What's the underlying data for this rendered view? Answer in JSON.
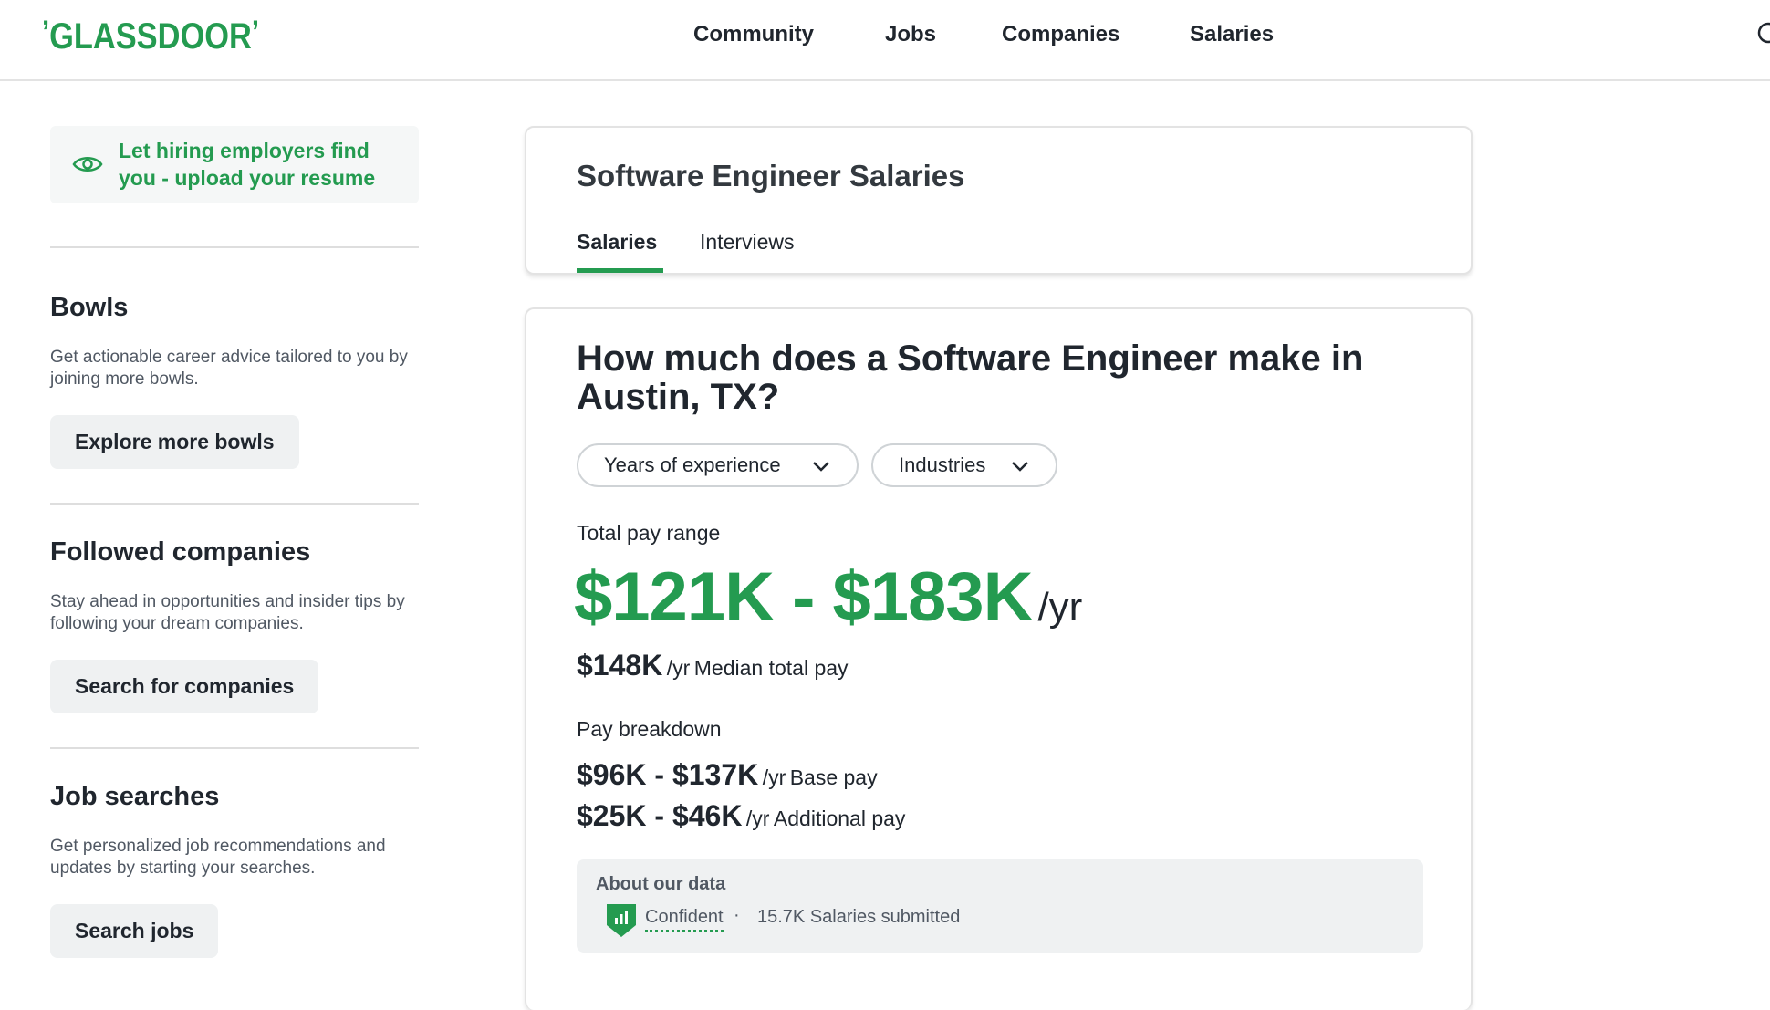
{
  "header": {
    "logo": "GLASSDOOR",
    "nav": [
      "Community",
      "Jobs",
      "Companies",
      "Salaries"
    ]
  },
  "sidebar": {
    "resume_prompt": "Let hiring employers find you - upload your resume",
    "sections": [
      {
        "title": "Bowls",
        "description": "Get actionable career advice tailored to you by joining more bowls.",
        "button": "Explore more bowls"
      },
      {
        "title": "Followed companies",
        "description": "Stay ahead in opportunities and insider tips by following your dream companies.",
        "button": "Search for companies"
      },
      {
        "title": "Job searches",
        "description": "Get personalized job recommendations and updates by starting your searches.",
        "button": "Search jobs"
      }
    ]
  },
  "salary_header": {
    "title": "Software Engineer Salaries",
    "tabs": [
      "Salaries",
      "Interviews"
    ],
    "active_tab": "Salaries"
  },
  "salary_main": {
    "question": "How much does a Software Engineer make in Austin, TX?",
    "filters": [
      "Years of experience",
      "Industries"
    ],
    "total_pay_label": "Total pay range",
    "total_pay_range": "$121K - $183K",
    "per_year": "/yr",
    "median_value": "$148K",
    "median_label": "Median total pay",
    "breakdown_label": "Pay breakdown",
    "base_pay_range": "$96K - $137K",
    "base_pay_label": "Base pay",
    "additional_pay_range": "$25K - $46K",
    "additional_pay_label": "Additional pay",
    "about": {
      "title": "About our data",
      "confidence": "Confident",
      "separator": "·",
      "submitted": "15.7K Salaries submitted"
    }
  },
  "colors": {
    "brand_green": "#249b50",
    "text": "#20262e",
    "muted": "#505863"
  }
}
